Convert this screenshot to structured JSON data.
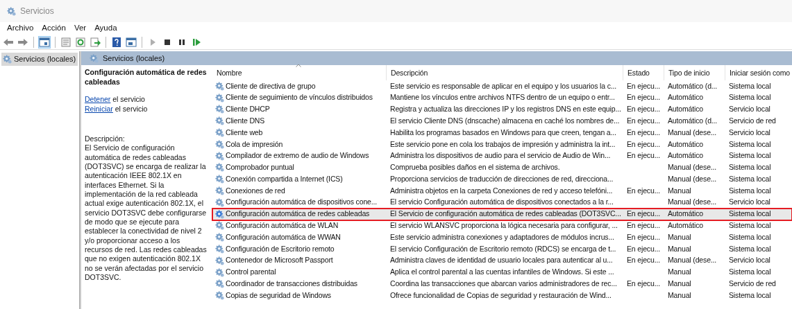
{
  "window": {
    "title": "Servicios"
  },
  "menu": [
    "Archivo",
    "Acción",
    "Ver",
    "Ayuda"
  ],
  "tree": [
    {
      "label": "Servicios (locales)",
      "selected": true
    }
  ],
  "panel_header": "Servicios (locales)",
  "detail": {
    "title": "Configuración automática de redes cableadas",
    "actions": [
      {
        "link": "Detener",
        "text": "el servicio"
      },
      {
        "link": "Reiniciar",
        "text": "el servicio"
      }
    ],
    "description_label": "Descripción:",
    "description": "El Servicio de configuración automática de redes cableadas (DOT3SVC) se encarga de realizar la autenticación IEEE 802.1X en interfaces Ethernet. Si la implementación de la red cableada actual exige autenticación 802.1X, el servicio DOT3SVC debe configurarse de modo que se ejecute para establecer la conectividad de nivel 2 y/o proporcionar acceso a los recursos de red. Las redes cableadas que no exigen autenticación 802.1X no se verán afectadas por el servicio DOT3SVC."
  },
  "table": {
    "columns": [
      {
        "label": "Nombre",
        "sorted": true
      },
      {
        "label": "Descripción",
        "sorted": false
      },
      {
        "label": "Estado",
        "sorted": false
      },
      {
        "label": "Tipo de inicio",
        "sorted": false
      },
      {
        "label": "Iniciar sesión como",
        "sorted": false
      }
    ],
    "rows": [
      {
        "name": "Cliente de directiva de grupo",
        "description": "Este servicio es responsable de aplicar en el equipo y los usuarios la c...",
        "status": "En ejecu...",
        "startup": "Automático (d...",
        "logon": "Sistema local",
        "selected": false
      },
      {
        "name": "Cliente de seguimiento de vínculos distribuidos",
        "description": "Mantiene los vínculos entre archivos NTFS dentro de un equipo o entr...",
        "status": "En ejecu...",
        "startup": "Automático",
        "logon": "Sistema local",
        "selected": false
      },
      {
        "name": "Cliente DHCP",
        "description": "Registra y actualiza las direcciones IP y los registros DNS en este equip...",
        "status": "En ejecu...",
        "startup": "Automático",
        "logon": "Servicio local",
        "selected": false
      },
      {
        "name": "Cliente DNS",
        "description": "El servicio Cliente DNS (dnscache) almacena en caché los nombres de...",
        "status": "En ejecu...",
        "startup": "Automático (d...",
        "logon": "Servicio de red",
        "selected": false
      },
      {
        "name": "Cliente web",
        "description": "Habilita los programas basados en Windows para que creen, tengan a...",
        "status": "En ejecu...",
        "startup": "Manual (dese...",
        "logon": "Servicio local",
        "selected": false
      },
      {
        "name": "Cola de impresión",
        "description": "Este servicio pone en cola los trabajos de impresión y administra la int...",
        "status": "En ejecu...",
        "startup": "Automático",
        "logon": "Sistema local",
        "selected": false
      },
      {
        "name": "Compilador de extremo de audio de Windows",
        "description": "Administra los dispositivos de audio para el servicio de Audio de Win...",
        "status": "En ejecu...",
        "startup": "Automático",
        "logon": "Sistema local",
        "selected": false
      },
      {
        "name": "Comprobador puntual",
        "description": "Comprueba posibles daños en el sistema de archivos.",
        "startup": "Manual (dese...",
        "logon": "Sistema local",
        "selected": false
      },
      {
        "name": "Conexión compartida a Internet (ICS)",
        "description": "Proporciona servicios de traducción de direcciones de red, direcciona...",
        "startup": "Manual (dese...",
        "logon": "Sistema local",
        "selected": false
      },
      {
        "name": "Conexiones de red",
        "description": "Administra objetos en la carpeta Conexiones de red y acceso telefóni...",
        "status": "En ejecu...",
        "startup": "Manual",
        "logon": "Sistema local",
        "selected": false
      },
      {
        "name": "Configuración automática de dispositivos cone...",
        "description": "El servicio Configuración automática de dispositivos conectados a la r...",
        "startup": "Manual (dese...",
        "logon": "Servicio local",
        "selected": false
      },
      {
        "name": "Configuración automática de redes cableadas",
        "description": "El Servicio de configuración automática de redes cableadas (DOT3SVC...",
        "status": "En ejecu...",
        "startup": "Automático",
        "logon": "Sistema local",
        "selected": true
      },
      {
        "name": "Configuración automática de WLAN",
        "description": "El servicio WLANSVC proporciona la lógica necesaria para configurar, ...",
        "status": "En ejecu...",
        "startup": "Automático",
        "logon": "Sistema local",
        "selected": false
      },
      {
        "name": "Configuración automática de WWAN",
        "description": "Este servicio administra conexiones y adaptadores de módulos incrus...",
        "status": "En ejecu...",
        "startup": "Manual",
        "logon": "Sistema local",
        "selected": false
      },
      {
        "name": "Configuración de Escritorio remoto",
        "description": "El servicio Configuración de Escritorio remoto (RDCS) se encarga de t...",
        "status": "En ejecu...",
        "startup": "Manual",
        "logon": "Sistema local",
        "selected": false
      },
      {
        "name": "Contenedor de Microsoft Passport",
        "description": "Administra claves de identidad de usuario locales para autenticar al u...",
        "status": "En ejecu...",
        "startup": "Manual (dese...",
        "logon": "Servicio local",
        "selected": false
      },
      {
        "name": "Control parental",
        "description": "Aplica el control parental a las cuentas infantiles de Windows. Si este ...",
        "startup": "Manual",
        "logon": "Sistema local",
        "selected": false
      },
      {
        "name": "Coordinador de transacciones distribuidas",
        "description": "Coordina las transacciones que abarcan varios administradores de rec...",
        "status": "En ejecu...",
        "startup": "Manual",
        "logon": "Servicio de red",
        "selected": false
      },
      {
        "name": "Copias de seguridad de Windows",
        "description": "Ofrece funcionalidad de Copias de seguridad y restauración de Wind...",
        "startup": "Manual",
        "logon": "Sistema local",
        "selected": false
      }
    ]
  }
}
